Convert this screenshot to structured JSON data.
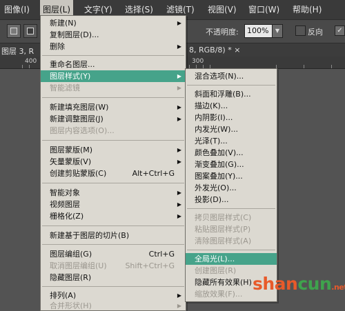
{
  "menubar": {
    "items": [
      {
        "label": "图像(I)"
      },
      {
        "label": "图层(L)"
      },
      {
        "label": "文字(Y)"
      },
      {
        "label": "选择(S)"
      },
      {
        "label": "滤镜(T)"
      },
      {
        "label": "视图(V)"
      },
      {
        "label": "窗口(W)"
      },
      {
        "label": "帮助(H)"
      }
    ]
  },
  "options": {
    "opacity_label": "不透明度:",
    "opacity_value": "100%",
    "reverse_label": "反向"
  },
  "doc_tab": {
    "title_left": "图层 3, R",
    "title_right": "8, RGB/8) * ×"
  },
  "ruler": {
    "labels": [
      "400",
      "300"
    ]
  },
  "layer_menu": {
    "items": [
      {
        "label": "新建(N)",
        "submenu": true
      },
      {
        "label": "复制图层(D)..."
      },
      {
        "label": "删除",
        "submenu": true
      },
      {
        "label": "重命名图层..."
      },
      {
        "label": "图层样式(Y)",
        "submenu": true
      },
      {
        "label": "智能滤镜",
        "submenu": true
      },
      {
        "label": "新建填充图层(W)",
        "submenu": true
      },
      {
        "label": "新建调整图层(J)",
        "submenu": true
      },
      {
        "label": "图层内容选项(O)..."
      },
      {
        "label": "图层蒙版(M)",
        "submenu": true
      },
      {
        "label": "矢量蒙版(V)",
        "submenu": true
      },
      {
        "label": "创建剪贴蒙版(C)",
        "shortcut": "Alt+Ctrl+G"
      },
      {
        "label": "智能对象",
        "submenu": true
      },
      {
        "label": "视频图层",
        "submenu": true
      },
      {
        "label": "栅格化(Z)",
        "submenu": true
      },
      {
        "label": "新建基于图层的切片(B)"
      },
      {
        "label": "图层编组(G)",
        "shortcut": "Ctrl+G"
      },
      {
        "label": "取消图层编组(U)",
        "shortcut": "Shift+Ctrl+G"
      },
      {
        "label": "隐藏图层(R)"
      },
      {
        "label": "排列(A)",
        "submenu": true
      },
      {
        "label": "合并形状(H)",
        "submenu": true
      }
    ]
  },
  "style_submenu": {
    "items": [
      {
        "label": "混合选项(N)..."
      },
      {
        "label": "斜面和浮雕(B)..."
      },
      {
        "label": "描边(K)..."
      },
      {
        "label": "内阴影(I)..."
      },
      {
        "label": "内发光(W)..."
      },
      {
        "label": "光泽(T)..."
      },
      {
        "label": "颜色叠加(V)..."
      },
      {
        "label": "渐变叠加(G)..."
      },
      {
        "label": "图案叠加(Y)..."
      },
      {
        "label": "外发光(O)..."
      },
      {
        "label": "投影(D)..."
      },
      {
        "label": "拷贝图层样式(C)"
      },
      {
        "label": "粘贴图层样式(P)"
      },
      {
        "label": "清除图层样式(A)"
      },
      {
        "label": "全局光(L)..."
      },
      {
        "label": "创建图层(R)"
      },
      {
        "label": "隐藏所有效果(H)"
      },
      {
        "label": "缩放效果(F)..."
      }
    ]
  },
  "watermark": {
    "text_a": "shan",
    "text_b": "cun",
    "text_c": ".net"
  }
}
